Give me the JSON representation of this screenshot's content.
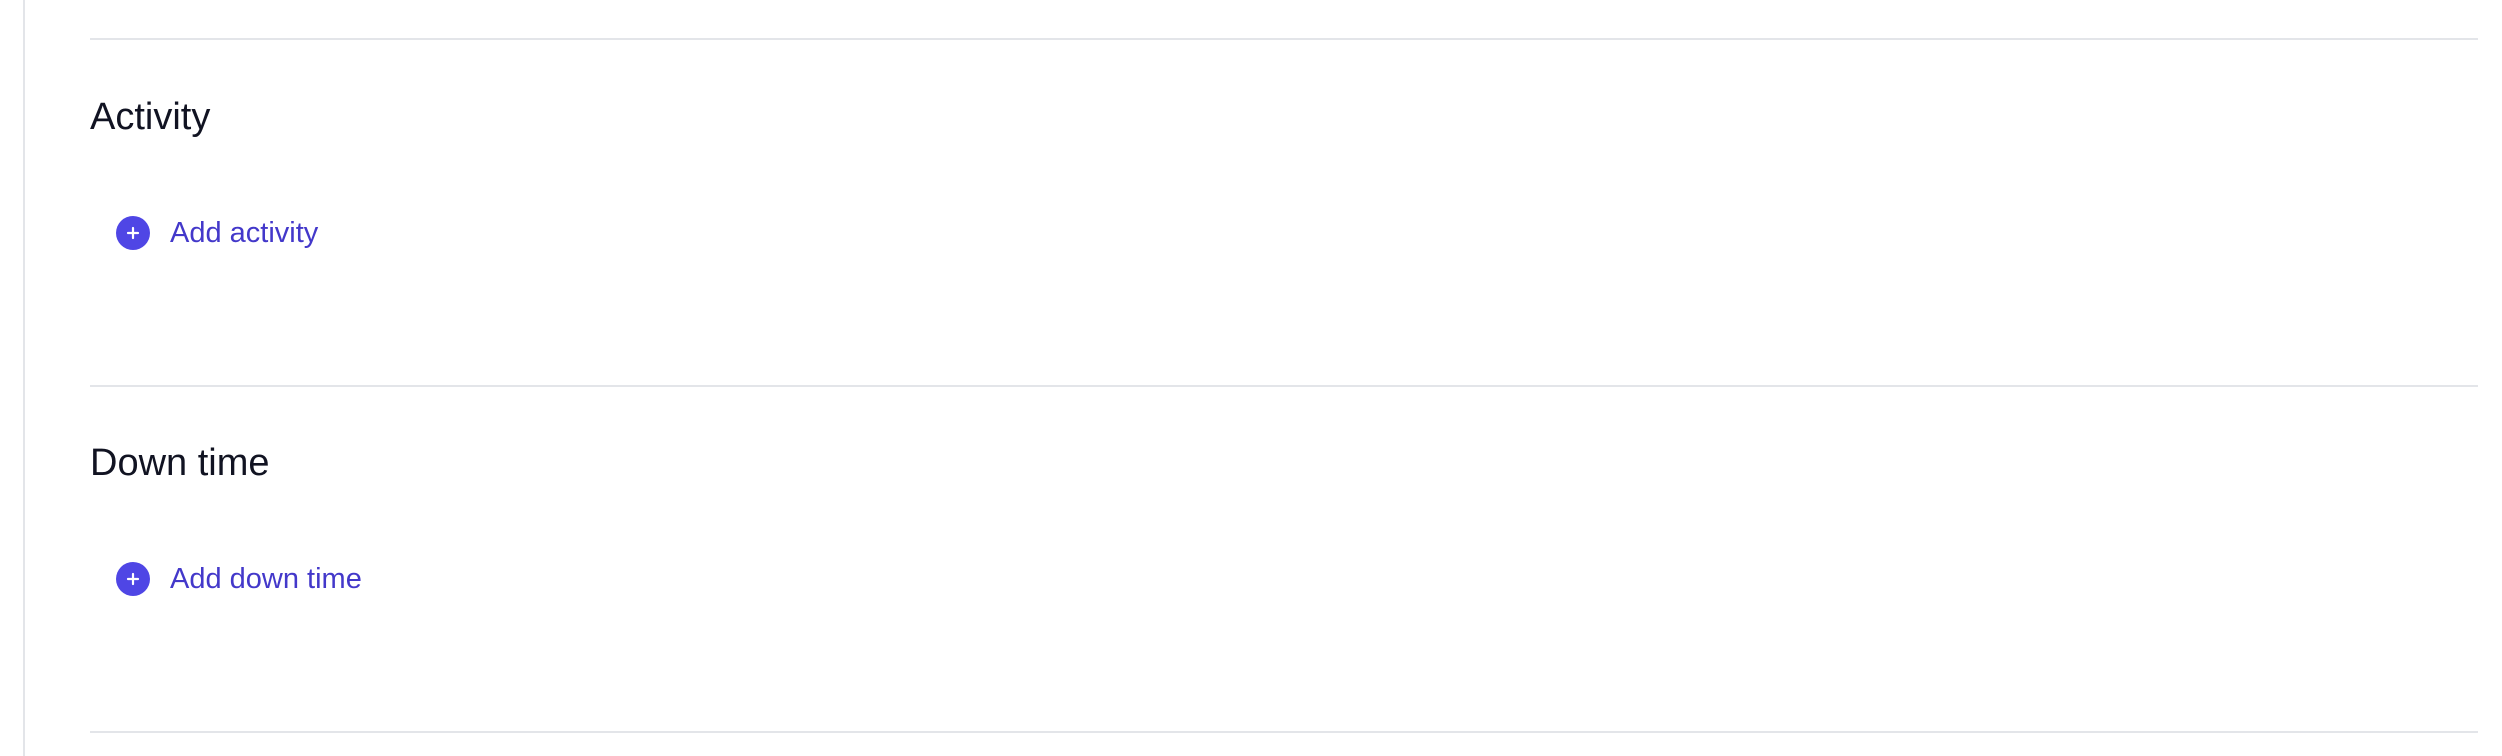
{
  "sections": [
    {
      "title": "Activity",
      "add_label": "Add activity",
      "icon": "plus-circle-icon"
    },
    {
      "title": "Down time",
      "add_label": "Add down time",
      "icon": "plus-circle-icon"
    }
  ],
  "colors": {
    "accent": "#4f46e5",
    "link_text": "#4338ca",
    "heading_text": "#111322",
    "divider": "#e3e5e9"
  }
}
